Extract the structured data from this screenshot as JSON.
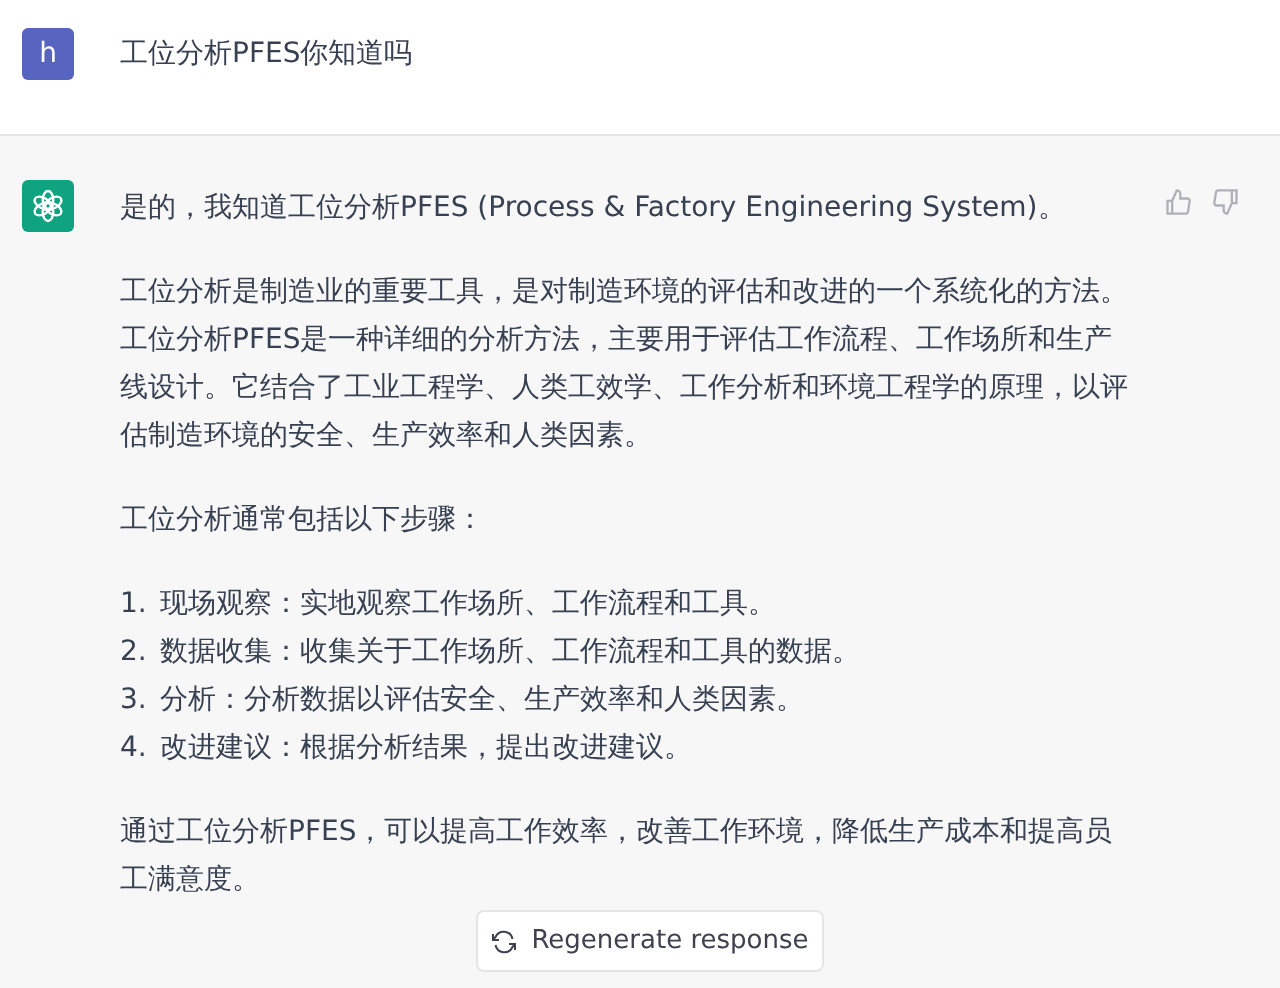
{
  "user_message": {
    "avatar": "h",
    "text": "工位分析PFES你知道吗"
  },
  "assistant_message": {
    "intro": "是的，我知道工位分析PFES (Process & Factory Engineering System)。",
    "paragraphs": [
      "工位分析是制造业的重要工具，是对制造环境的评估和改进的一个系统化的方法。工位分析PFES是一种详细的分析方法，主要用于评估工作流程、工作场所和生产线设计。它结合了工业工程学、人类工效学、工作分析和环境工程学的原理，以评估制造环境的安全、生产效率和人类因素。",
      "工位分析通常包括以下步骤："
    ],
    "steps": [
      {
        "number": "1.",
        "text": "现场观察：实地观察工作场所、工作流程和工具。"
      },
      {
        "number": "2.",
        "text": "数据收集：收集关于工作场所、工作流程和工具的数据。"
      },
      {
        "number": "3.",
        "text": "分析：分析数据以评估安全、生产效率和人类因素。"
      },
      {
        "number": "4.",
        "text": "改进建议：根据分析结果，提出改进建议。"
      }
    ],
    "conclusion": "通过工位分析PFES，可以提高工作效率，改善工作环境，降低生产成本和提高员工满意度。"
  },
  "regenerate_button": {
    "label": "Regenerate response"
  }
}
